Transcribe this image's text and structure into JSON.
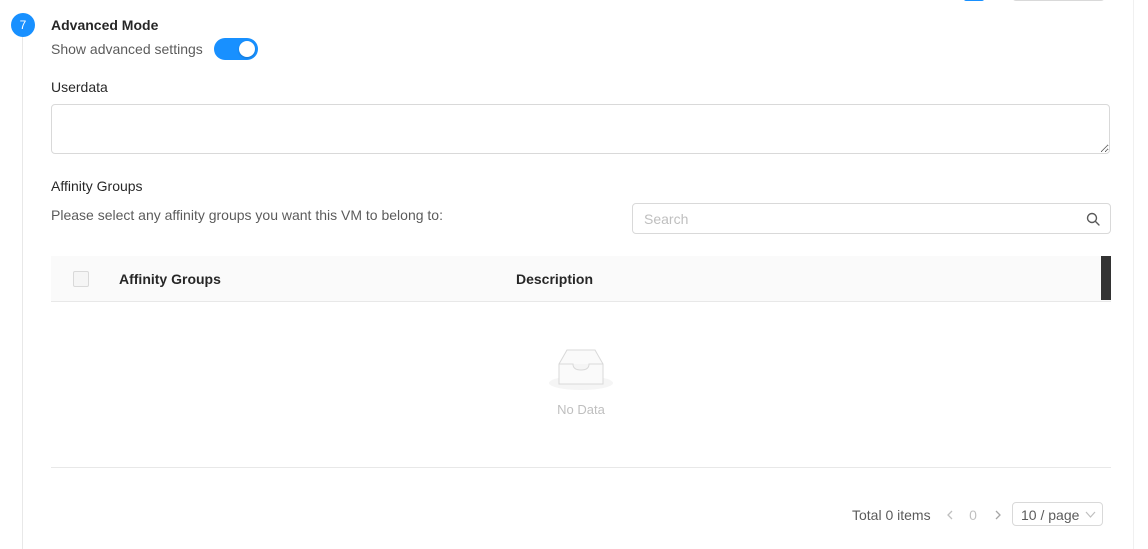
{
  "step": {
    "number": "7"
  },
  "advanced": {
    "title": "Advanced Mode",
    "toggle_label": "Show advanced settings",
    "toggle_on": true
  },
  "userdata": {
    "label": "Userdata",
    "value": ""
  },
  "affinity": {
    "label": "Affinity Groups",
    "hint": "Please select any affinity groups you want this VM to belong to:",
    "search_placeholder": "Search",
    "columns": [
      "Affinity Groups",
      "Description"
    ],
    "rows": [],
    "empty_text": "No Data"
  },
  "pagination": {
    "total": "Total 0 items",
    "current_page": "0",
    "page_size": "10 / page"
  },
  "colors": {
    "accent": "#1890ff",
    "border": "#d9d9d9",
    "header_bg": "#fafafa"
  },
  "icons": {
    "search": "search-icon",
    "prev": "chevron-left-icon",
    "next": "chevron-right-icon",
    "select": "chevron-down-icon",
    "empty": "inbox-icon"
  }
}
